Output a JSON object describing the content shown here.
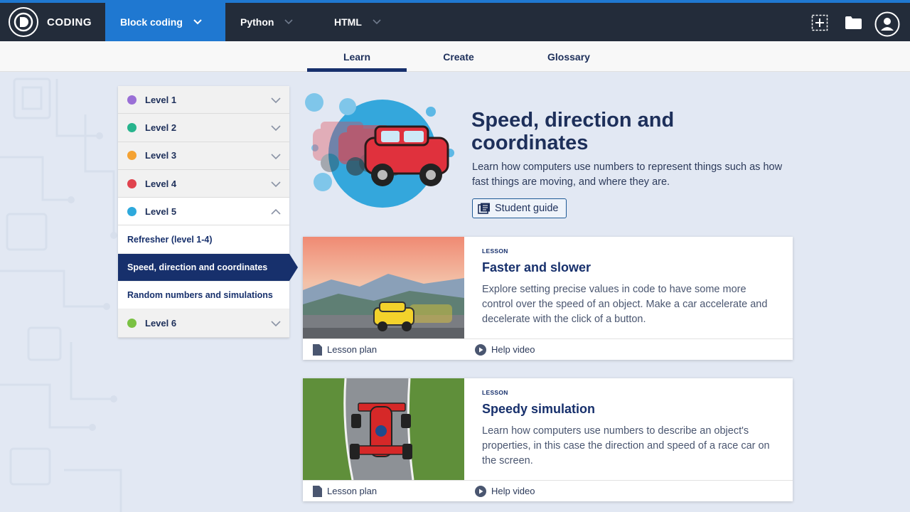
{
  "brand": {
    "name": "CODING"
  },
  "nav": {
    "tabs": [
      {
        "label": "Block coding",
        "active": true
      },
      {
        "label": "Python"
      },
      {
        "label": "HTML"
      }
    ]
  },
  "subnav": {
    "tabs": [
      "Learn",
      "Create",
      "Glossary"
    ],
    "active": "Learn"
  },
  "sidebar": {
    "levels": [
      {
        "label": "Level 1",
        "color": "#9a6fd6"
      },
      {
        "label": "Level 2",
        "color": "#27b48d"
      },
      {
        "label": "Level 3",
        "color": "#f4a233"
      },
      {
        "label": "Level 4",
        "color": "#e0434e"
      },
      {
        "label": "Level 5",
        "color": "#2ea9dc"
      },
      {
        "label": "Level 6",
        "color": "#7ac143"
      }
    ],
    "level5_items": [
      "Refresher (level 1-4)",
      "Speed, direction and coordinates",
      "Random numbers and simulations"
    ]
  },
  "hero": {
    "title": "Speed, direction and coordinates",
    "description": "Learn how computers use numbers to represent things such as how fast things are moving, and where they are.",
    "guide_label": "Student guide"
  },
  "lessons": [
    {
      "tag": "LESSON",
      "title": "Faster and slower",
      "description": "Explore setting precise values in code to have some more control over the speed of an object. Make a car accelerate and decelerate with the click of a button.",
      "plan_label": "Lesson plan",
      "video_label": "Help video"
    },
    {
      "tag": "LESSON",
      "title": "Speedy simulation",
      "description": "Learn how computers use numbers to describe an object's properties, in this case the direction and speed of a race car on the screen.",
      "plan_label": "Lesson plan",
      "video_label": "Help video"
    }
  ]
}
